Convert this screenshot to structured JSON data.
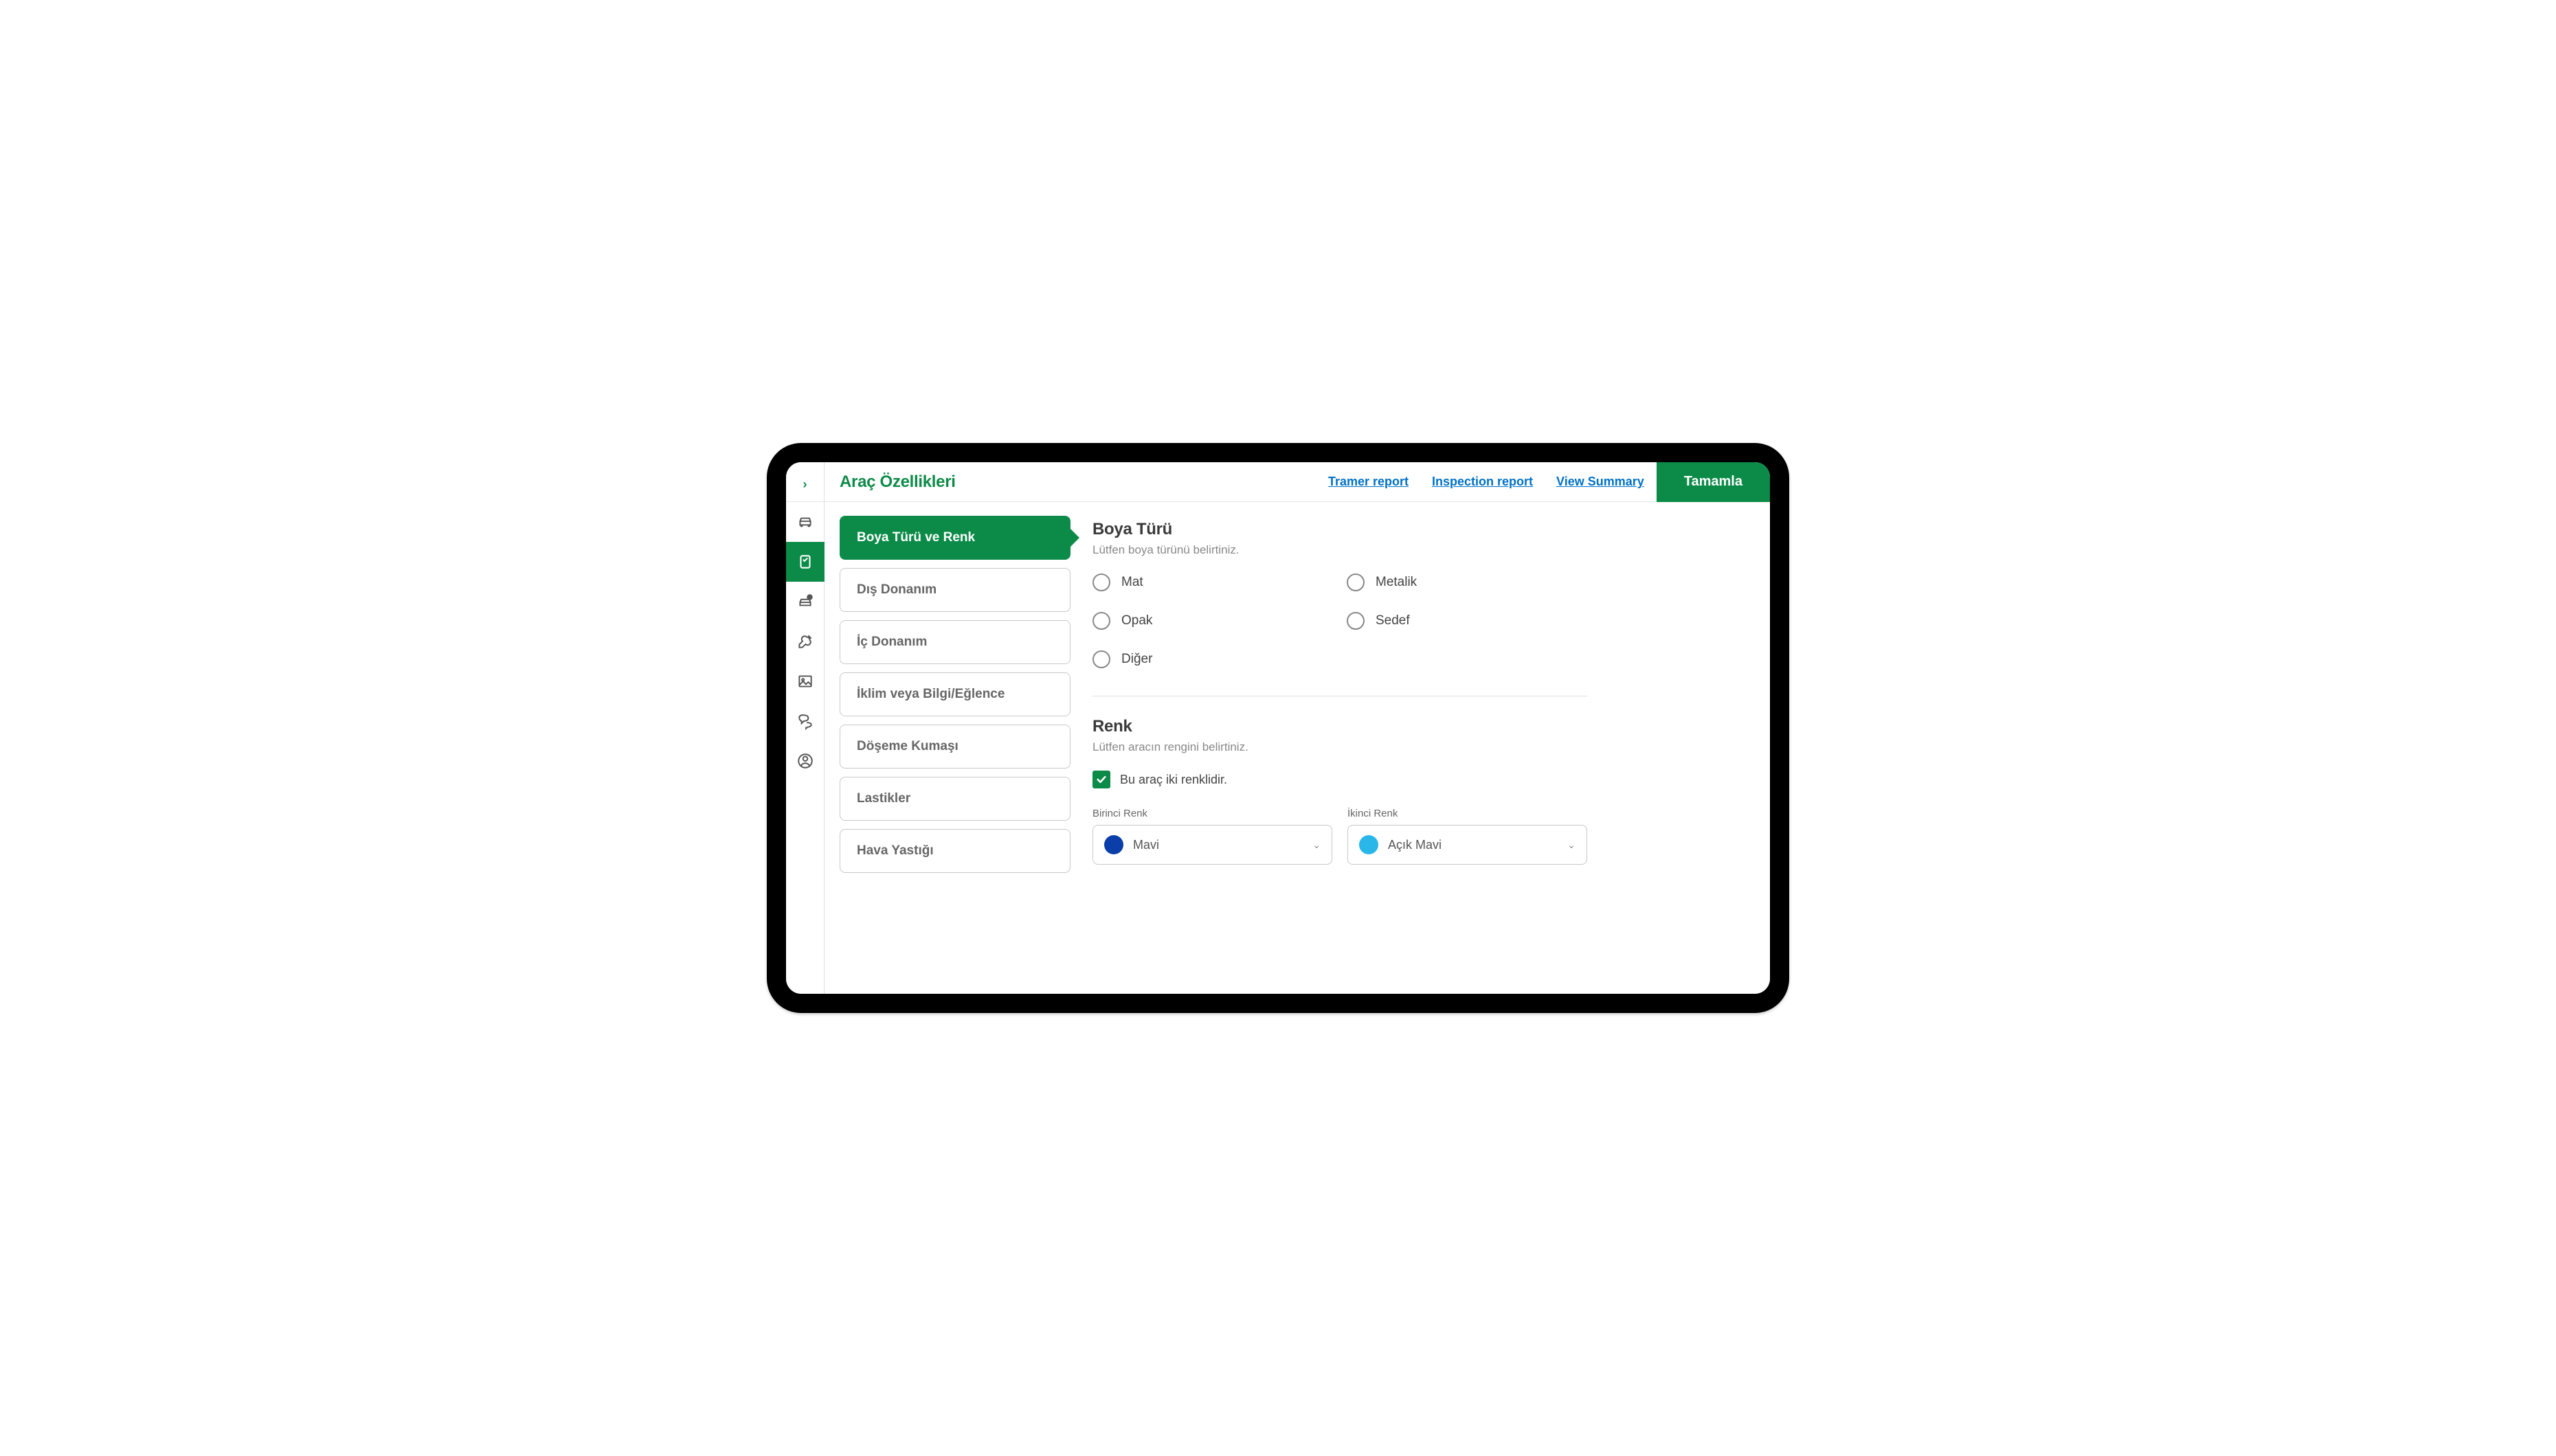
{
  "colors": {
    "primary": "#0c8b48",
    "link": "#0071c7",
    "swatch_blue": "#0b3ea8",
    "swatch_lightblue": "#29b6e8"
  },
  "header": {
    "title": "Araç Özellikleri",
    "links": {
      "tramer": "Tramer report",
      "inspection": "Inspection report",
      "summary": "View Summary"
    },
    "complete_btn": "Tamamla"
  },
  "sections": {
    "paint": "Boya Türü ve Renk",
    "exterior": "Dış Donanım",
    "interior": "İç Donanım",
    "climate": "İklim veya Bilgi/Eğlence",
    "upholstery": "Döşeme Kumaşı",
    "tires": "Lastikler",
    "airbag": "Hava Yastığı"
  },
  "paint_type": {
    "title": "Boya Türü",
    "subtitle": "Lütfen boya türünü belirtiniz.",
    "options": {
      "mat": "Mat",
      "metalik": "Metalik",
      "opak": "Opak",
      "sedef": "Sedef",
      "diger": "Diğer"
    }
  },
  "color": {
    "title": "Renk",
    "subtitle": "Lütfen aracın rengini belirtiniz.",
    "two_color_checkbox": "Bu araç iki renklidir.",
    "first_label": "Birinci Renk",
    "first_value": "Mavi",
    "second_label": "İkinci Renk",
    "second_value": "Açık Mavi"
  }
}
